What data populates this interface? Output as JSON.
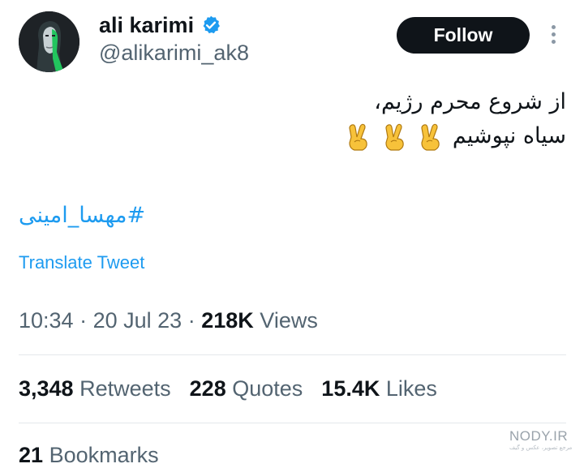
{
  "user": {
    "name": "ali karimi",
    "handle": "@alikarimi_ak8",
    "verified": true
  },
  "actions": {
    "follow_label": "Follow"
  },
  "tweet": {
    "line1": "از شروع محرم رژیم،",
    "line2": "سیاه نپوشیم",
    "emoji_count": 3,
    "hashtag": "#مهسا_امینی",
    "translate_label": "Translate Tweet"
  },
  "meta": {
    "time": "10:34",
    "date": "20 Jul 23",
    "views_count": "218K",
    "views_label": "Views",
    "separator": "·"
  },
  "stats": {
    "retweets": {
      "count": "3,348",
      "label": "Retweets"
    },
    "quotes": {
      "count": "228",
      "label": "Quotes"
    },
    "likes": {
      "count": "15.4K",
      "label": "Likes"
    },
    "bookmarks": {
      "count": "21",
      "label": "Bookmarks"
    }
  },
  "watermark": {
    "text": "NODY.IR",
    "subtext": "مرجع تصویر، عکس و گیف"
  },
  "colors": {
    "accent": "#1d9bf0",
    "text": "#0f1419",
    "muted": "#536471",
    "divider": "#e4e8eb"
  }
}
